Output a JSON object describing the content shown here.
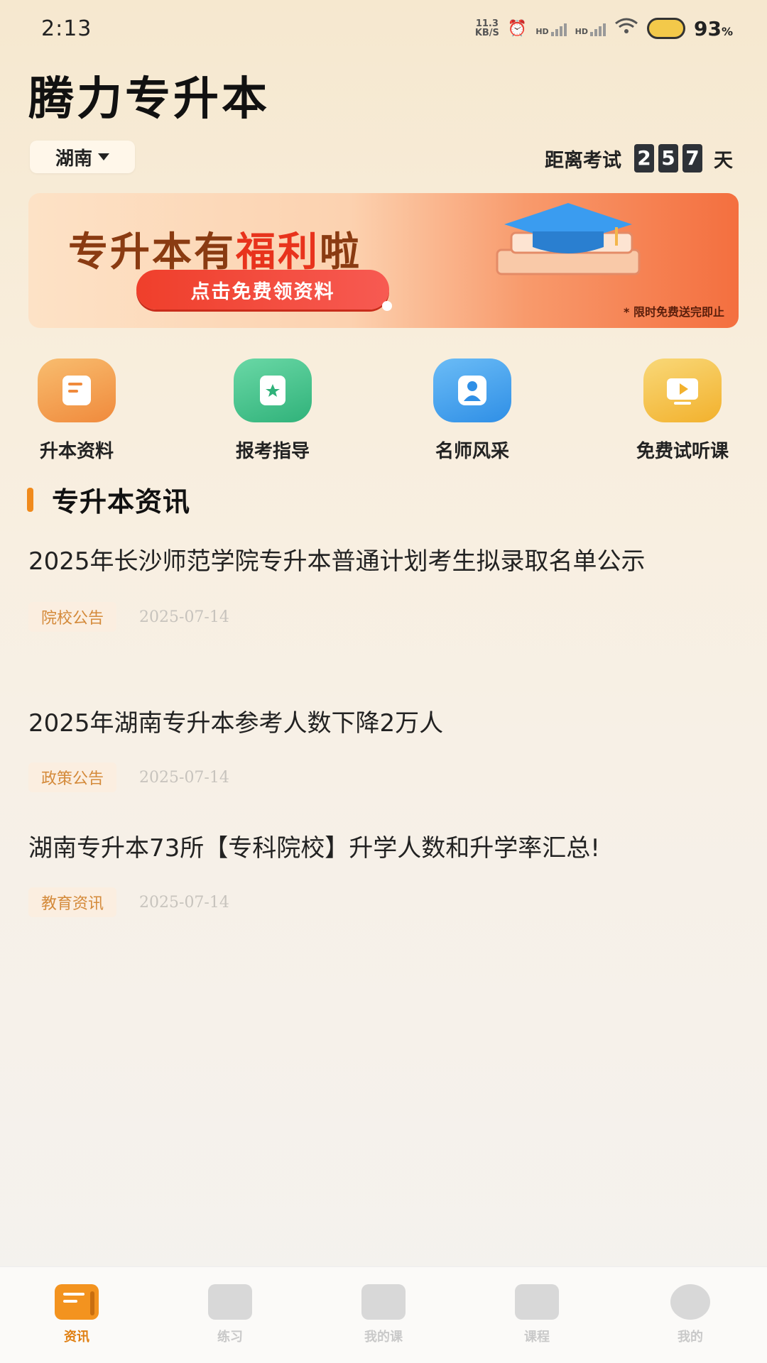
{
  "status_bar": {
    "time": "2:13",
    "net_speed_value": "11.3",
    "net_speed_unit": "KB/S",
    "sim1": "HD",
    "sim2": "HD",
    "battery": "93",
    "battery_unit": "%"
  },
  "app": {
    "title": "腾力专升本"
  },
  "region": {
    "selected": "湖南"
  },
  "countdown": {
    "label": "距离考试",
    "digits": [
      "2",
      "5",
      "7"
    ],
    "unit": "天"
  },
  "banner": {
    "headline_pre": "专升本有",
    "headline_highlight": "福利",
    "headline_post": "啦",
    "cta": "点击免费领资料",
    "note": "* 限时免费送完即止"
  },
  "quick_entries": [
    {
      "label": "升本资料",
      "icon": "document-icon",
      "color": "#f3a152"
    },
    {
      "label": "报考指导",
      "icon": "star-book-icon",
      "color": "#45c48f"
    },
    {
      "label": "名师风采",
      "icon": "teacher-icon",
      "color": "#4aa6f0"
    },
    {
      "label": "免费试听课",
      "icon": "video-play-icon",
      "color": "#f4c23e"
    }
  ],
  "section": {
    "title": "专升本资讯"
  },
  "news": [
    {
      "title": "2025年长沙师范学院专升本普通计划考生拟录取名单公示",
      "tag": "院校公告",
      "date": "2025-07-14"
    },
    {
      "title": "2025年湖南专升本参考人数下降2万人",
      "tag": "政策公告",
      "date": "2025-07-14"
    },
    {
      "title": "湖南专升本73所【专科院校】升学人数和升学率汇总!",
      "tag": "教育资讯",
      "date": "2025-07-14"
    }
  ],
  "tabs": [
    {
      "label": "资讯",
      "active": true
    },
    {
      "label": "练习",
      "active": false
    },
    {
      "label": "我的课",
      "active": false
    },
    {
      "label": "课程",
      "active": false
    },
    {
      "label": "我的",
      "active": false
    }
  ]
}
